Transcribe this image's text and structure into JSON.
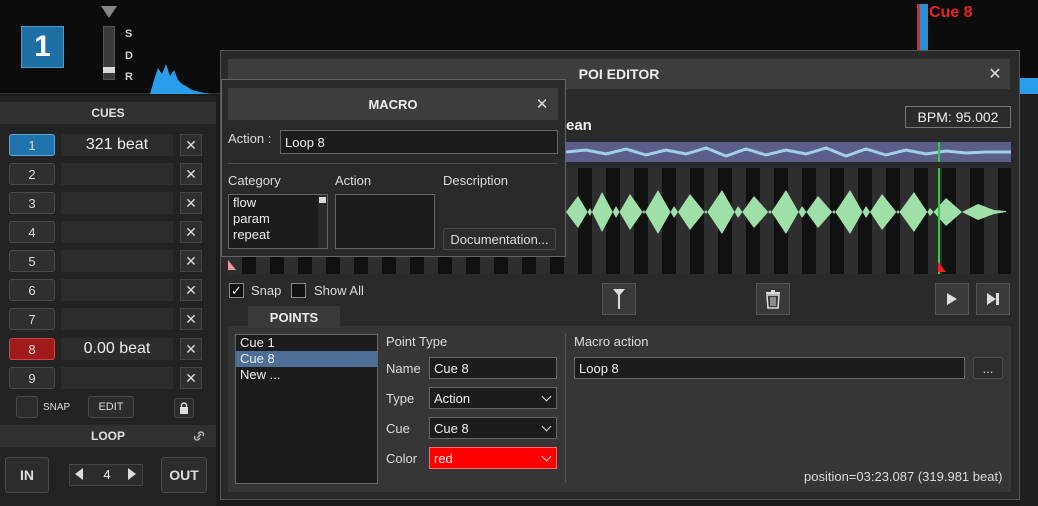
{
  "deck": {
    "number": "1",
    "sdr_labels": [
      "S",
      "D",
      "R"
    ],
    "top_cue_label": "Cue 8"
  },
  "cues": {
    "header": "CUES",
    "items": [
      {
        "num": "1",
        "value": "321 beat",
        "color": "#1f74ad"
      },
      {
        "num": "2",
        "value": ""
      },
      {
        "num": "3",
        "value": ""
      },
      {
        "num": "4",
        "value": ""
      },
      {
        "num": "5",
        "value": ""
      },
      {
        "num": "6",
        "value": ""
      },
      {
        "num": "7",
        "value": ""
      },
      {
        "num": "8",
        "value": "0.00 beat",
        "color": "#a01c1c"
      },
      {
        "num": "9",
        "value": ""
      }
    ],
    "delete_glyph": "✕",
    "snap_label": "SNAP",
    "edit_label": "EDIT"
  },
  "loop": {
    "header": "LOOP",
    "in_label": "IN",
    "out_label": "OUT",
    "size": "4"
  },
  "poi_editor": {
    "title": "POI EDITOR",
    "close_glyph": "✕",
    "bpm": "BPM: 95.002",
    "track_fragment": "ean",
    "snap": {
      "label": "Snap",
      "checked": true
    },
    "show_all": {
      "label": "Show All",
      "checked": false
    },
    "points_tab": "POINTS",
    "points_list": [
      "Cue 1",
      "Cue 8",
      "New ..."
    ],
    "selected_point": "Cue 8",
    "point_type_header": "Point Type",
    "name": {
      "label": "Name",
      "value": "Cue 8"
    },
    "type": {
      "label": "Type",
      "value": "Action"
    },
    "cue": {
      "label": "Cue",
      "value": "Cue 8"
    },
    "color": {
      "label": "Color",
      "value": "red",
      "swatch": "#ff0000"
    },
    "macro_action": {
      "header": "Macro action",
      "value": "Loop 8",
      "button": "..."
    },
    "position": "position=03:23.087 (319.981 beat)"
  },
  "macro": {
    "title": "MACRO",
    "close_glyph": "✕",
    "action_label": "Action :",
    "action_value": "Loop 8",
    "category_header": "Category",
    "action_header": "Action",
    "description_header": "Description",
    "categories": [
      "flow",
      "param",
      "repeat"
    ],
    "documentation_button": "Documentation..."
  }
}
